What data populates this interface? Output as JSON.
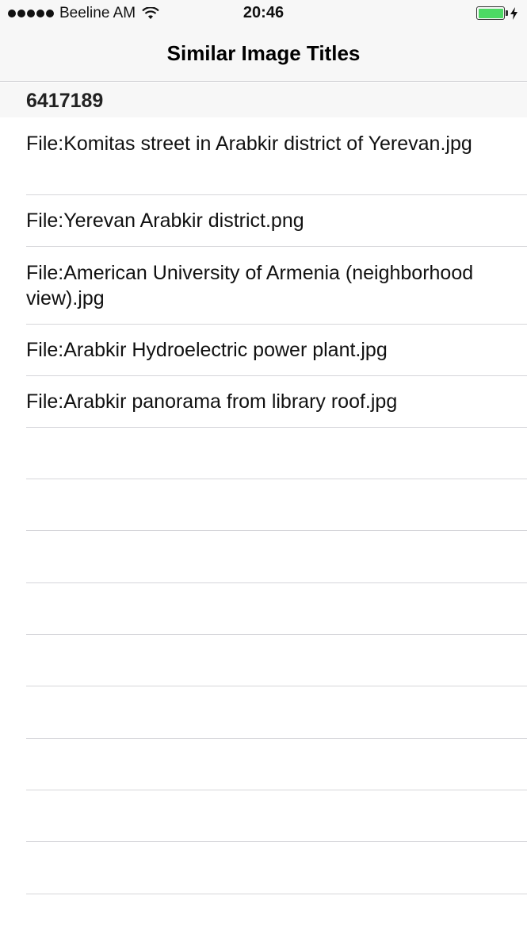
{
  "status_bar": {
    "carrier": "Beeline AM",
    "time": "20:46",
    "battery_color": "#4cd964",
    "signal_icon": "signal-dots-icon",
    "wifi_icon": "wifi-icon",
    "battery_icon": "battery-icon",
    "charging_icon": "charging-bolt-icon"
  },
  "nav": {
    "title": "Similar Image Titles"
  },
  "section": {
    "header": "6417189"
  },
  "items": [
    {
      "label": "File:Komitas street in Arabkir district of Yerevan.jpg"
    },
    {
      "label": "File:Yerevan Arabkir district.png"
    },
    {
      "label": "File:American University of Armenia (neighborhood view).jpg"
    },
    {
      "label": "File:Arabkir Hydroelectric power plant.jpg"
    },
    {
      "label": "File:Arabkir panorama from library roof.jpg"
    },
    {
      "label": ""
    },
    {
      "label": ""
    },
    {
      "label": ""
    },
    {
      "label": ""
    },
    {
      "label": ""
    },
    {
      "label": ""
    },
    {
      "label": ""
    },
    {
      "label": ""
    },
    {
      "label": ""
    }
  ]
}
